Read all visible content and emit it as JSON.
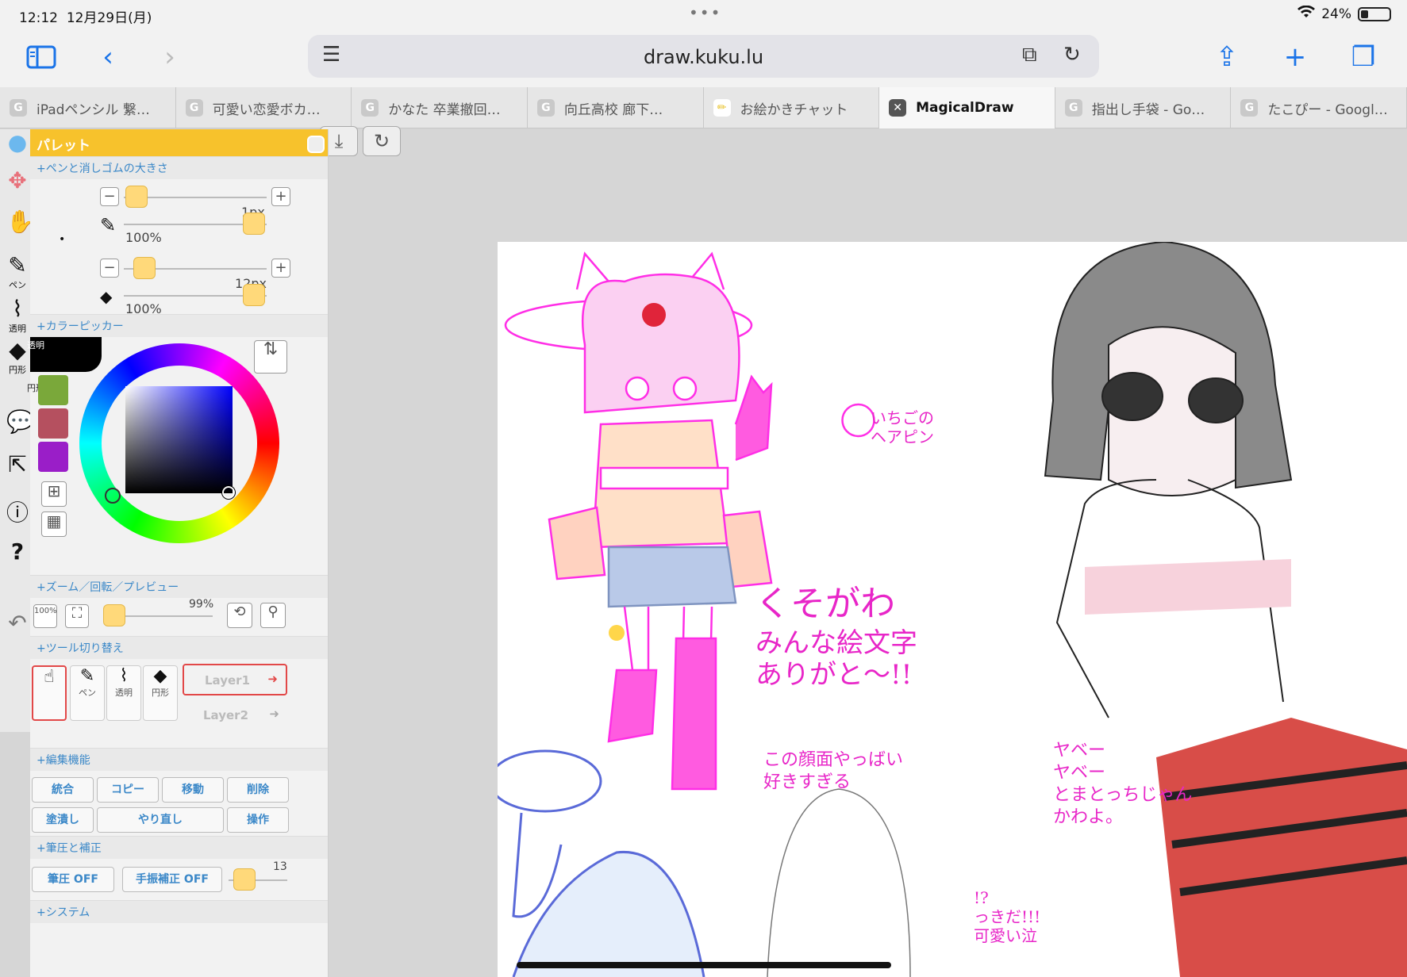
{
  "status": {
    "time": "12:12",
    "date": "12月29日(月)",
    "battery": "24%"
  },
  "browser": {
    "url": "draw.kuku.lu"
  },
  "tabs": [
    {
      "label": "iPadペンシル 繋…",
      "icon": "G"
    },
    {
      "label": "可愛い恋愛ボカ…",
      "icon": "G"
    },
    {
      "label": "かなた 卒業撤回…",
      "icon": "G"
    },
    {
      "label": "向丘高校 廊下…",
      "icon": "G"
    },
    {
      "label": "お絵かきチャット",
      "icon": "✏"
    },
    {
      "label": "MagicalDraw",
      "icon": "✕"
    },
    {
      "label": "指出し手袋 - Go…",
      "icon": "G"
    },
    {
      "label": "たこぴー - Googl…",
      "icon": "G"
    }
  ],
  "tools_left": {
    "pen": "ペン",
    "transparent": "透明",
    "circle": "円形"
  },
  "palette": {
    "title": "パレット",
    "pen_eraser_section": "+ペンと消しゴムの大きさ",
    "pen_size": "1px",
    "pen_opacity": "100%",
    "eraser_size": "12px",
    "eraser_opacity": "100%",
    "color_picker_section": "+カラーピッカー",
    "transparent_label": "透明",
    "circle_label": "円形",
    "swatches": [
      "#000000",
      "#7aa83a",
      "#b5505f",
      "#9a1ec8"
    ],
    "zoom_section": "+ズーム／回転／プレビュー",
    "zoom_reset": "100%",
    "zoom_value": "99%",
    "tool_switch_section": "+ツール切り替え",
    "tool_pen": "ペン",
    "tool_transparent": "透明",
    "tool_circle": "円形",
    "layer1": "Layer1",
    "layer2": "Layer2",
    "edit_section": "+編集機能",
    "btn_merge": "統合",
    "btn_copy": "コピー",
    "btn_move": "移動",
    "btn_delete": "削除",
    "btn_fill": "塗潰し",
    "btn_redo": "やり直し",
    "btn_operate": "操作",
    "pressure_section": "+筆圧と補正",
    "btn_pressure": "筆圧 OFF",
    "btn_stabilizer": "手振補正 OFF",
    "stabilizer_value": "13",
    "system_section": "+システム"
  },
  "canvas_text": {
    "t1": "いちごの\nヘアピン",
    "t2": "くそがわ",
    "t3": "みんな絵文字\nありがと〜!!",
    "t4": "この顔面やっばい\n好きすぎる",
    "t5": "ヤベー\nヤベー\nとまとっちじゃん\nかわよ。",
    "t6": "!?\nっきだ!!!\n可愛い泣"
  }
}
